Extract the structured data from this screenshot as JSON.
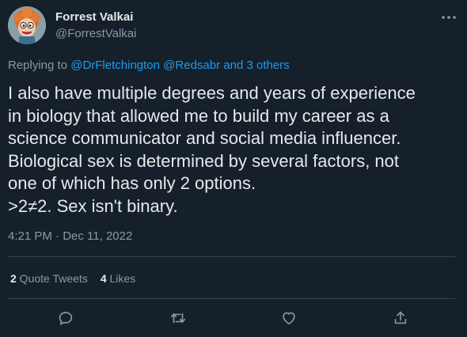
{
  "author": {
    "display_name": "Forrest Valkai",
    "handle": "@ForrestValkai"
  },
  "replying": {
    "prefix": "Replying to ",
    "mention1": "@DrFletchington",
    "mention2": "@Redsabr",
    "and_others": " and 3 others"
  },
  "tweet": {
    "text": "I also have multiple degrees and years of experience\nin biology that allowed me to build my career as a\nscience communicator and social media influencer.\nBiological sex is determined by several factors, not\none of which has only 2 options.\n>2≠2. Sex isn't binary.",
    "timestamp": "4:21 PM · Dec 11, 2022"
  },
  "stats": {
    "quote_count": "2",
    "quote_label": " Quote Tweets",
    "like_count": "4",
    "like_label": " Likes"
  },
  "icons": {
    "more": "more-dots-icon",
    "reply": "reply-icon",
    "retweet": "retweet-icon",
    "like": "heart-icon",
    "share": "share-icon"
  },
  "colors": {
    "background": "#15202b",
    "text": "#e7e9ea",
    "secondary": "#8b98a5",
    "link": "#1d9bf0",
    "divider": "#38444d"
  }
}
